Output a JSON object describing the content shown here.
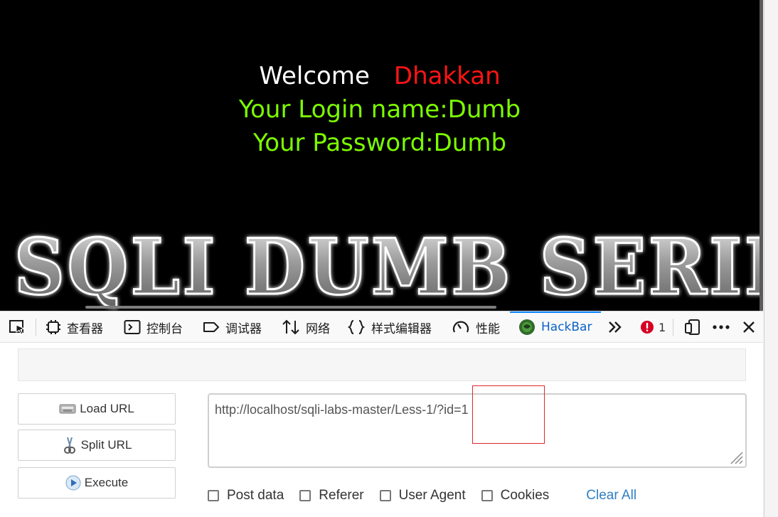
{
  "page": {
    "welcome_word": "Welcome",
    "user_name": "Dhakkan",
    "login_line": "Your Login name:Dumb",
    "password_line": "Your Password:Dumb",
    "banner_text": "SQLI DUMB SERIES"
  },
  "devtools": {
    "tabs": [
      {
        "label": "查看器",
        "icon": "inspector-icon"
      },
      {
        "label": "控制台",
        "icon": "console-icon"
      },
      {
        "label": "调试器",
        "icon": "debugger-icon"
      },
      {
        "label": "网络",
        "icon": "network-icon"
      },
      {
        "label": "样式编辑器",
        "icon": "style-editor-icon"
      },
      {
        "label": "性能",
        "icon": "performance-icon"
      },
      {
        "label": "HackBar",
        "icon": "hackbar-icon"
      }
    ],
    "active_tab": "HackBar",
    "error_count": "1"
  },
  "hackbar": {
    "load_url_label": "Load URL",
    "split_url_label": "Split URL",
    "execute_label": "Execute",
    "url_value": "http://localhost/sqli-labs-master/Less-1/?id=1",
    "options": [
      "Post data",
      "Referer",
      "User Agent",
      "Cookies"
    ],
    "clear_all_label": "Clear All"
  },
  "colors": {
    "welcome": "#ffffff",
    "user_name": "#ff1414",
    "credentials": "#7cfc00",
    "active_tab": "#0a63c9",
    "highlight_box": "#e0262b",
    "clear_all": "#2f7ec4"
  }
}
